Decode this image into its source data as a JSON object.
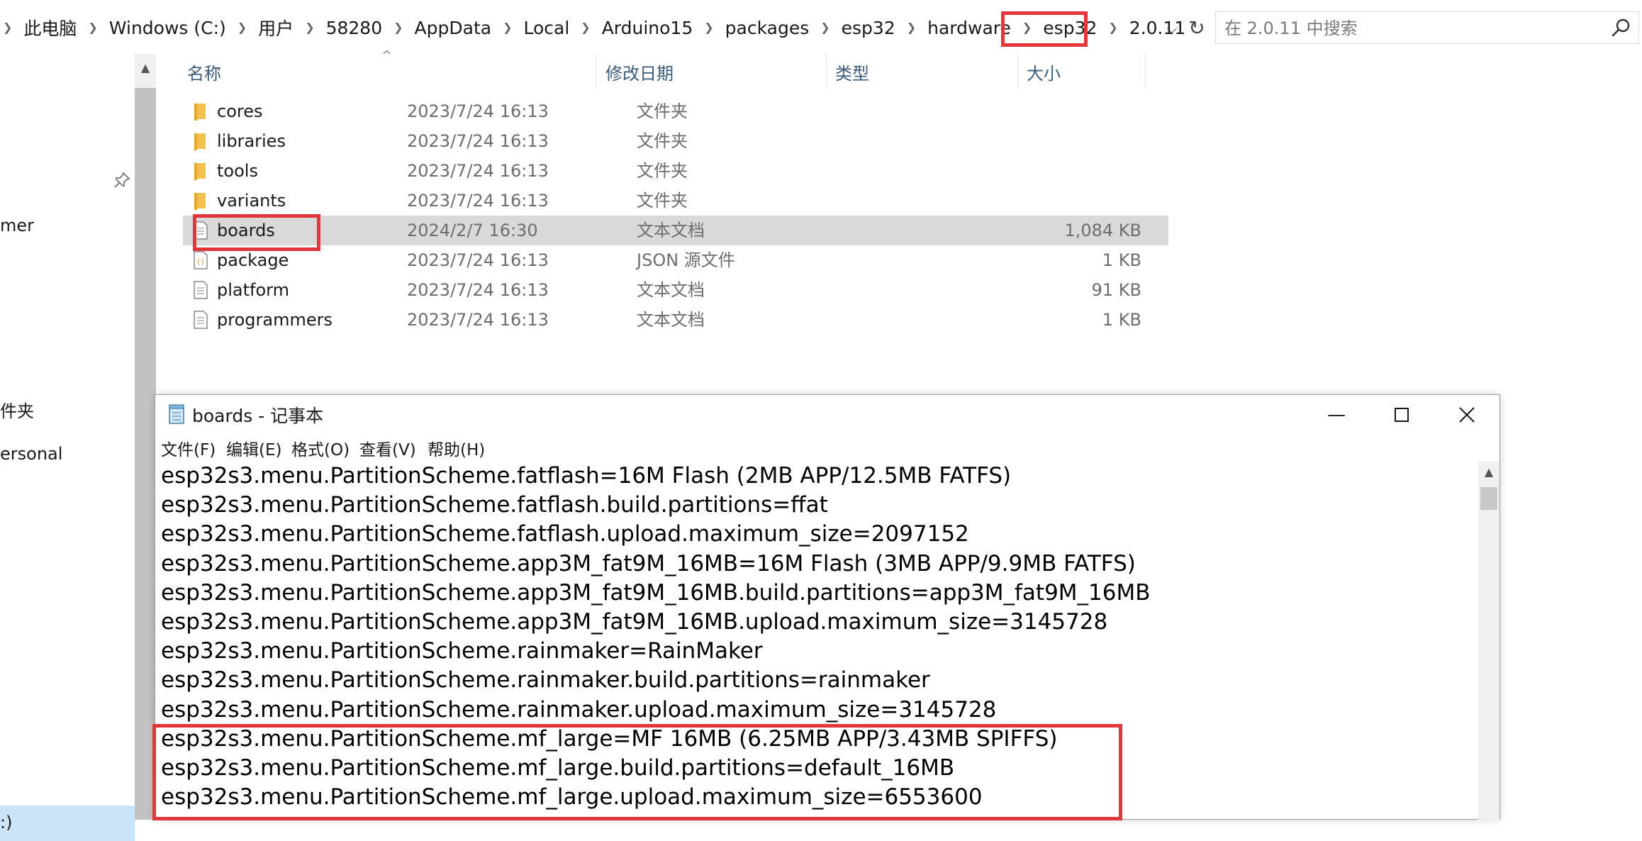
{
  "address_bar": {
    "crumbs": [
      "此电脑",
      "Windows (C:)",
      "用户",
      "58280",
      "AppData",
      "Local",
      "Arduino15",
      "packages",
      "esp32",
      "hardware",
      "esp32",
      "2.0.11"
    ],
    "search_placeholder": "在 2.0.11 中搜索"
  },
  "nav_pane": {
    "items": [
      "mer",
      "件夹",
      "ersonal",
      ":)"
    ]
  },
  "file_list": {
    "columns": {
      "name": "名称",
      "date": "修改日期",
      "type": "类型",
      "size": "大小"
    },
    "rows": [
      {
        "name": "cores",
        "date": "2023/7/24 16:13",
        "type": "文件夹",
        "size": "",
        "icon": "folder-icon"
      },
      {
        "name": "libraries",
        "date": "2023/7/24 16:13",
        "type": "文件夹",
        "size": "",
        "icon": "folder-icon"
      },
      {
        "name": "tools",
        "date": "2023/7/24 16:13",
        "type": "文件夹",
        "size": "",
        "icon": "folder-icon"
      },
      {
        "name": "variants",
        "date": "2023/7/24 16:13",
        "type": "文件夹",
        "size": "",
        "icon": "folder-icon"
      },
      {
        "name": "boards",
        "date": "2024/2/7 16:30",
        "type": "文本文档",
        "size": "1,084 KB",
        "icon": "text-file-icon",
        "selected": true
      },
      {
        "name": "package",
        "date": "2023/7/24 16:13",
        "type": "JSON 源文件",
        "size": "1 KB",
        "icon": "json-file-icon"
      },
      {
        "name": "platform",
        "date": "2023/7/24 16:13",
        "type": "文本文档",
        "size": "91 KB",
        "icon": "text-file-icon"
      },
      {
        "name": "programmers",
        "date": "2023/7/24 16:13",
        "type": "文本文档",
        "size": "1 KB",
        "icon": "text-file-icon"
      }
    ]
  },
  "notepad": {
    "title": "boards - 记事本",
    "menu": [
      "文件(F)",
      "编辑(E)",
      "格式(O)",
      "查看(V)",
      "帮助(H)"
    ],
    "lines": [
      "esp32s3.menu.PartitionScheme.fatflash=16M Flash (2MB APP/12.5MB FATFS)",
      "esp32s3.menu.PartitionScheme.fatflash.build.partitions=ffat",
      "esp32s3.menu.PartitionScheme.fatflash.upload.maximum_size=2097152",
      "esp32s3.menu.PartitionScheme.app3M_fat9M_16MB=16M Flash (3MB APP/9.9MB FATFS)",
      "esp32s3.menu.PartitionScheme.app3M_fat9M_16MB.build.partitions=app3M_fat9M_16MB",
      "esp32s3.menu.PartitionScheme.app3M_fat9M_16MB.upload.maximum_size=3145728",
      "esp32s3.menu.PartitionScheme.rainmaker=RainMaker",
      "esp32s3.menu.PartitionScheme.rainmaker.build.partitions=rainmaker",
      "esp32s3.menu.PartitionScheme.rainmaker.upload.maximum_size=3145728",
      "esp32s3.menu.PartitionScheme.mf_large=MF 16MB (6.25MB APP/3.43MB SPIFFS)",
      "esp32s3.menu.PartitionScheme.mf_large.build.partitions=default_16MB",
      "esp32s3.menu.PartitionScheme.mf_large.upload.maximum_size=6553600"
    ]
  },
  "colors": {
    "highlight": "#e3353b",
    "selected_row": "#d9d9d9",
    "header_text": "#3b5b7a",
    "folder": "#f2c14e"
  }
}
